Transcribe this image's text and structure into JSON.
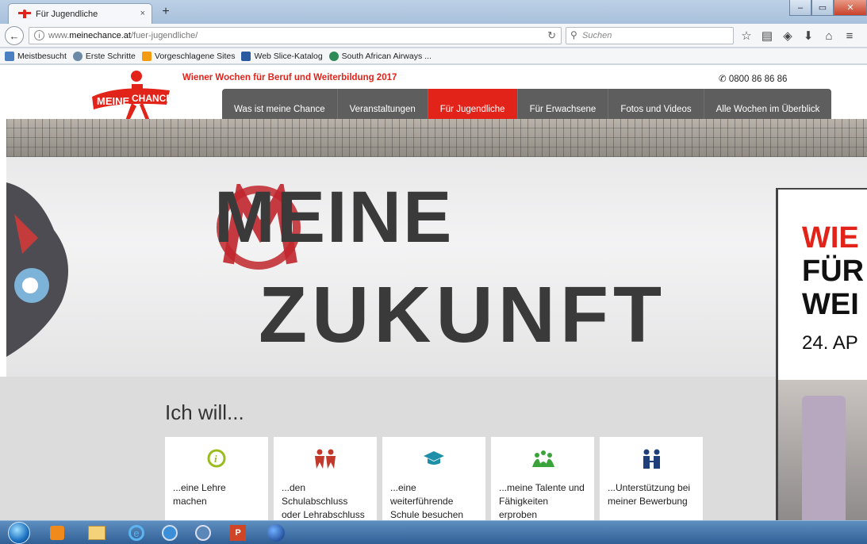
{
  "browser": {
    "tab_title": "Für Jugendliche",
    "tab_close": "×",
    "new_tab": "+",
    "url_prefix": "www.",
    "url_domain": "meinechance.at",
    "url_path": "/fuer-jugendliche/",
    "search_placeholder": "Suchen",
    "window_min": "–",
    "window_max": "▭",
    "window_close": "✕"
  },
  "bookmarks": [
    {
      "label": "Meistbesucht",
      "color": "#4a7fc1"
    },
    {
      "label": "Erste Schritte",
      "color": "#6c8aa6"
    },
    {
      "label": "Vorgeschlagene Sites",
      "color": "#f39c12"
    },
    {
      "label": "Web Slice-Katalog",
      "color": "#2a5aa0"
    },
    {
      "label": "South African Airways ...",
      "color": "#2e8b57"
    }
  ],
  "site": {
    "logo_text_left": "MEINE",
    "logo_text_right": "CHANCE",
    "tagline": "Wiener Wochen für Beruf und Weiterbildung 2017",
    "phone": "0800 86 86 86",
    "brand_red": "#e2231a",
    "menu": [
      {
        "label": "Was ist meine Chance",
        "active": false
      },
      {
        "label": "Veranstaltungen",
        "active": false
      },
      {
        "label": "Für Jugendliche",
        "active": true
      },
      {
        "label": "Für Erwachsene",
        "active": false
      },
      {
        "label": "Fotos und Videos",
        "active": false
      },
      {
        "label": "Alle Wochen im Überblick",
        "active": false
      }
    ],
    "hero": {
      "line1": "MEINE",
      "line2": "ZUKUNFT"
    },
    "ad": {
      "line1": "WIE",
      "line2": "FÜR",
      "line3": "WEI",
      "line4": "24. AP"
    },
    "section_title": "Ich will...",
    "cards": [
      {
        "label": "...eine Lehre machen",
        "icon": "info-circle-icon",
        "color": "#9abc1d"
      },
      {
        "label": "...den Schulabschluss oder Lehrabschluss",
        "icon": "people-icon",
        "color": "#c0392b"
      },
      {
        "label": "...eine weiterführende Schule besuchen",
        "icon": "graduation-cap-icon",
        "color": "#1d8fa8"
      },
      {
        "label": "...meine Talente und Fähigkeiten erproben",
        "icon": "group-icon",
        "color": "#3aa33a"
      },
      {
        "label": "...Unterstützung bei meiner Bewerbung",
        "icon": "consulting-icon",
        "color": "#1f3f7a"
      }
    ]
  },
  "taskbar": {
    "apps": [
      "start-orb",
      "media-player",
      "file-explorer",
      "internet-explorer",
      "skype-like",
      "lync",
      "powerpoint",
      "browser-globe"
    ]
  }
}
